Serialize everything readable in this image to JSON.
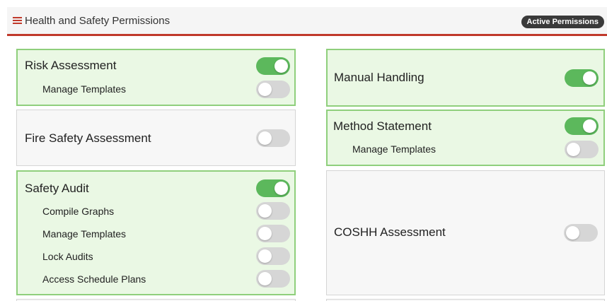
{
  "header": {
    "menu_icon": "hamburger-icon",
    "title": "Health and Safety Permissions",
    "badge": "Active Permissions",
    "accent_color": "#c0392b"
  },
  "colors": {
    "toggle_on": "#5cb85c",
    "toggle_off": "#d6d6d6",
    "card_on_bg": "#eaf8e4",
    "card_on_border": "#8fcf7c"
  },
  "left": {
    "risk_assessment": {
      "label": "Risk Assessment",
      "enabled": true,
      "manage_templates": {
        "label": "Manage Templates",
        "enabled": false
      }
    },
    "fire_safety": {
      "label": "Fire Safety Assessment",
      "enabled": false
    },
    "safety_audit": {
      "label": "Safety Audit",
      "enabled": true,
      "compile_graphs": {
        "label": "Compile Graphs",
        "enabled": false
      },
      "manage_templates": {
        "label": "Manage Templates",
        "enabled": false
      },
      "lock_audits": {
        "label": "Lock Audits",
        "enabled": false
      },
      "access_schedule_plans": {
        "label": "Access Schedule Plans",
        "enabled": false
      }
    }
  },
  "right": {
    "manual_handling": {
      "label": "Manual Handling",
      "enabled": true
    },
    "method_statement": {
      "label": "Method Statement",
      "enabled": true,
      "manage_templates": {
        "label": "Manage Templates",
        "enabled": false
      }
    },
    "coshh": {
      "label": "COSHH Assessment",
      "enabled": false
    }
  }
}
